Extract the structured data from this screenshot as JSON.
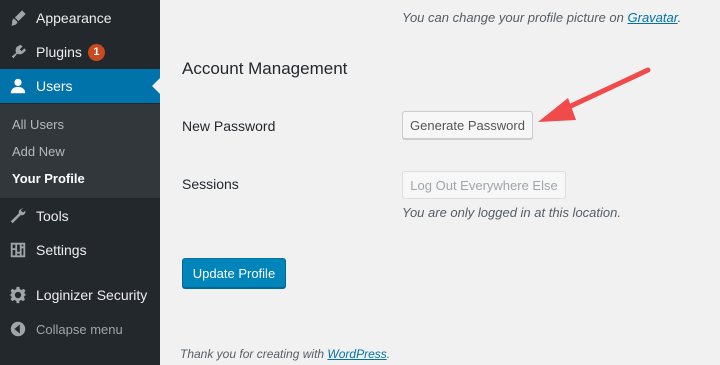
{
  "sidebar": {
    "items": [
      {
        "label": "Appearance",
        "icon": "paintbrush-icon"
      },
      {
        "label": "Plugins",
        "icon": "plugin-icon",
        "badge": "1"
      },
      {
        "label": "Users",
        "icon": "user-icon",
        "current": true
      },
      {
        "label": "Tools",
        "icon": "wrench-icon"
      },
      {
        "label": "Settings",
        "icon": "settings-icon"
      },
      {
        "label": "Loginizer Security",
        "icon": "gear-icon"
      }
    ],
    "submenu": [
      "All Users",
      "Add New",
      "Your Profile"
    ],
    "collapse_label": "Collapse menu"
  },
  "profile_picture": {
    "text": "You can change your profile picture on",
    "link": "Gravatar",
    "suffix": "."
  },
  "account_management": {
    "title": "Account Management",
    "new_password_label": "New Password",
    "generate_password_button": "Generate Password",
    "sessions_label": "Sessions",
    "logout_button": "Log Out Everywhere Else",
    "sessions_note": "You are only logged in at this location."
  },
  "update_button": "Update Profile",
  "footer": {
    "text": "Thank you for creating with",
    "link": "WordPress",
    "suffix": "."
  },
  "colors": {
    "sidebar_bg": "#23282d",
    "submenu_bg": "#32373c",
    "accent": "#0073aa",
    "primary_button": "#0085ba",
    "badge": "#ca4a1f",
    "annotation_arrow": "#f04a4a"
  }
}
